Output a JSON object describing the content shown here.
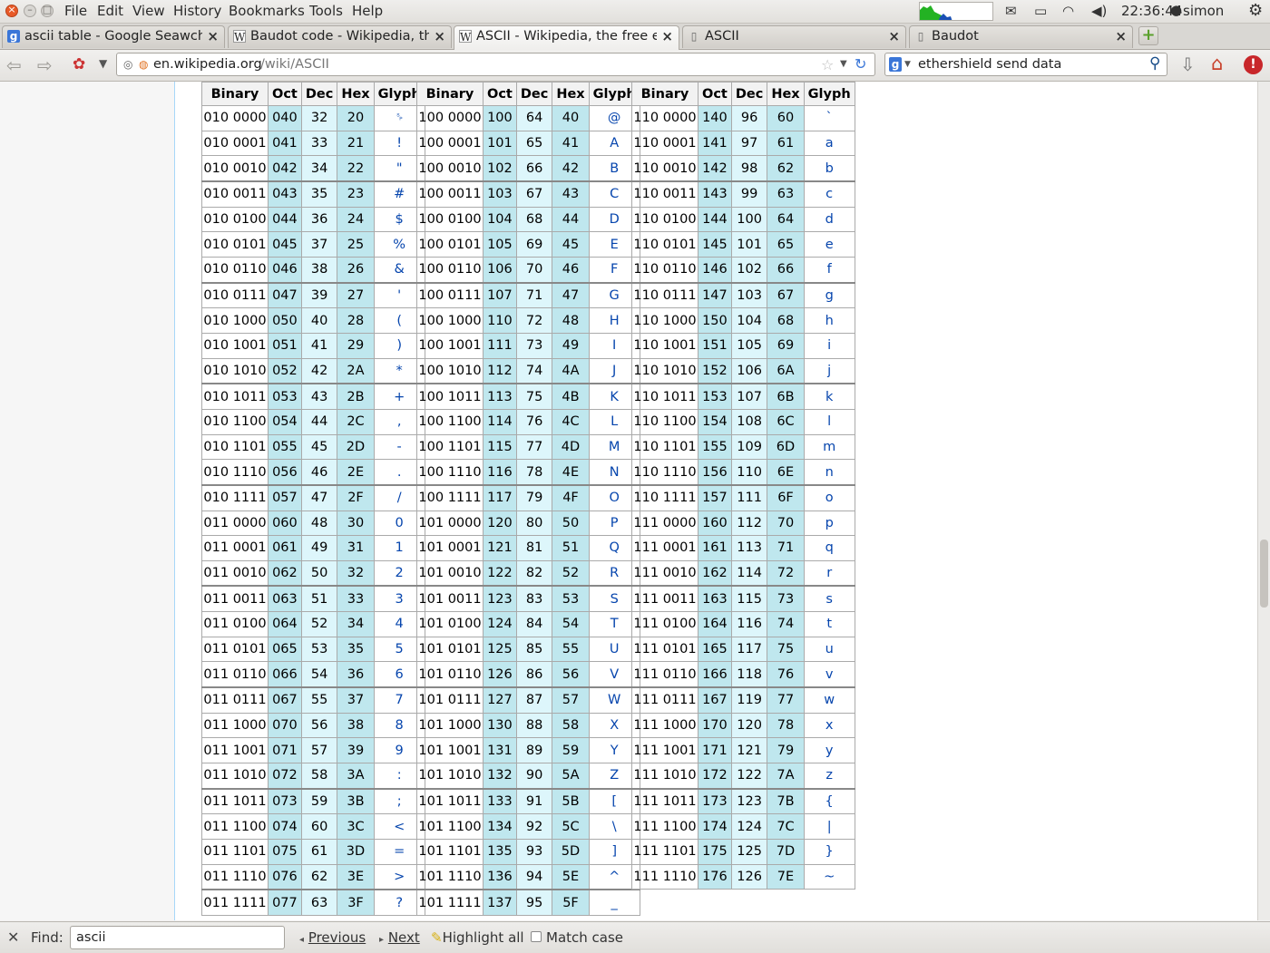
{
  "menubar": {
    "items": [
      "File",
      "Edit",
      "View",
      "History",
      "Bookmarks",
      "Tools",
      "Help"
    ],
    "clock": "22:36:44",
    "user": "simon"
  },
  "tabs": [
    {
      "label": "ascii table - Google Seawch",
      "favicon": "google-icon"
    },
    {
      "label": "Baudot code - Wikipedia, th…",
      "favicon": "wikipedia-icon"
    },
    {
      "label": "ASCII - Wikipedia, the free e…",
      "favicon": "wikipedia-icon",
      "active": true
    },
    {
      "label": "ASCII",
      "favicon": "page-icon"
    },
    {
      "label": "Baudot",
      "favicon": "page-icon"
    }
  ],
  "navbar": {
    "url_domain": "en.wikipedia.org",
    "url_path": "/wiki/ASCII",
    "search_value": "ethershield send data"
  },
  "table": {
    "headers": [
      "Binary",
      "Oct",
      "Dec",
      "Hex",
      "Glyph"
    ],
    "columns": [
      [
        [
          "010 0000",
          "040",
          "32",
          "20",
          "␠"
        ],
        [
          "010 0001",
          "041",
          "33",
          "21",
          "!"
        ],
        [
          "010 0010",
          "042",
          "34",
          "22",
          "\""
        ],
        [
          "010 0011",
          "043",
          "35",
          "23",
          "#"
        ],
        [
          "010 0100",
          "044",
          "36",
          "24",
          "$"
        ],
        [
          "010 0101",
          "045",
          "37",
          "25",
          "%"
        ],
        [
          "010 0110",
          "046",
          "38",
          "26",
          "&"
        ],
        [
          "010 0111",
          "047",
          "39",
          "27",
          "'"
        ],
        [
          "010 1000",
          "050",
          "40",
          "28",
          "("
        ],
        [
          "010 1001",
          "051",
          "41",
          "29",
          ")"
        ],
        [
          "010 1010",
          "052",
          "42",
          "2A",
          "*"
        ],
        [
          "010 1011",
          "053",
          "43",
          "2B",
          "+"
        ],
        [
          "010 1100",
          "054",
          "44",
          "2C",
          ","
        ],
        [
          "010 1101",
          "055",
          "45",
          "2D",
          "-"
        ],
        [
          "010 1110",
          "056",
          "46",
          "2E",
          "."
        ],
        [
          "010 1111",
          "057",
          "47",
          "2F",
          "/"
        ],
        [
          "011 0000",
          "060",
          "48",
          "30",
          "0"
        ],
        [
          "011 0001",
          "061",
          "49",
          "31",
          "1"
        ],
        [
          "011 0010",
          "062",
          "50",
          "32",
          "2"
        ],
        [
          "011 0011",
          "063",
          "51",
          "33",
          "3"
        ],
        [
          "011 0100",
          "064",
          "52",
          "34",
          "4"
        ],
        [
          "011 0101",
          "065",
          "53",
          "35",
          "5"
        ],
        [
          "011 0110",
          "066",
          "54",
          "36",
          "6"
        ],
        [
          "011 0111",
          "067",
          "55",
          "37",
          "7"
        ],
        [
          "011 1000",
          "070",
          "56",
          "38",
          "8"
        ],
        [
          "011 1001",
          "071",
          "57",
          "39",
          "9"
        ],
        [
          "011 1010",
          "072",
          "58",
          "3A",
          ":"
        ],
        [
          "011 1011",
          "073",
          "59",
          "3B",
          ";"
        ],
        [
          "011 1100",
          "074",
          "60",
          "3C",
          "<"
        ],
        [
          "011 1101",
          "075",
          "61",
          "3D",
          "="
        ],
        [
          "011 1110",
          "076",
          "62",
          "3E",
          ">"
        ],
        [
          "011 1111",
          "077",
          "63",
          "3F",
          "?"
        ]
      ],
      [
        [
          "100 0000",
          "100",
          "64",
          "40",
          "@"
        ],
        [
          "100 0001",
          "101",
          "65",
          "41",
          "A"
        ],
        [
          "100 0010",
          "102",
          "66",
          "42",
          "B"
        ],
        [
          "100 0011",
          "103",
          "67",
          "43",
          "C"
        ],
        [
          "100 0100",
          "104",
          "68",
          "44",
          "D"
        ],
        [
          "100 0101",
          "105",
          "69",
          "45",
          "E"
        ],
        [
          "100 0110",
          "106",
          "70",
          "46",
          "F"
        ],
        [
          "100 0111",
          "107",
          "71",
          "47",
          "G"
        ],
        [
          "100 1000",
          "110",
          "72",
          "48",
          "H"
        ],
        [
          "100 1001",
          "111",
          "73",
          "49",
          "I"
        ],
        [
          "100 1010",
          "112",
          "74",
          "4A",
          "J"
        ],
        [
          "100 1011",
          "113",
          "75",
          "4B",
          "K"
        ],
        [
          "100 1100",
          "114",
          "76",
          "4C",
          "L"
        ],
        [
          "100 1101",
          "115",
          "77",
          "4D",
          "M"
        ],
        [
          "100 1110",
          "116",
          "78",
          "4E",
          "N"
        ],
        [
          "100 1111",
          "117",
          "79",
          "4F",
          "O"
        ],
        [
          "101 0000",
          "120",
          "80",
          "50",
          "P"
        ],
        [
          "101 0001",
          "121",
          "81",
          "51",
          "Q"
        ],
        [
          "101 0010",
          "122",
          "82",
          "52",
          "R"
        ],
        [
          "101 0011",
          "123",
          "83",
          "53",
          "S"
        ],
        [
          "101 0100",
          "124",
          "84",
          "54",
          "T"
        ],
        [
          "101 0101",
          "125",
          "85",
          "55",
          "U"
        ],
        [
          "101 0110",
          "126",
          "86",
          "56",
          "V"
        ],
        [
          "101 0111",
          "127",
          "87",
          "57",
          "W"
        ],
        [
          "101 1000",
          "130",
          "88",
          "58",
          "X"
        ],
        [
          "101 1001",
          "131",
          "89",
          "59",
          "Y"
        ],
        [
          "101 1010",
          "132",
          "90",
          "5A",
          "Z"
        ],
        [
          "101 1011",
          "133",
          "91",
          "5B",
          "["
        ],
        [
          "101 1100",
          "134",
          "92",
          "5C",
          "\\"
        ],
        [
          "101 1101",
          "135",
          "93",
          "5D",
          "]"
        ],
        [
          "101 1110",
          "136",
          "94",
          "5E",
          "^"
        ],
        [
          "101 1111",
          "137",
          "95",
          "5F",
          "_"
        ]
      ],
      [
        [
          "110 0000",
          "140",
          "96",
          "60",
          "`"
        ],
        [
          "110 0001",
          "141",
          "97",
          "61",
          "a"
        ],
        [
          "110 0010",
          "142",
          "98",
          "62",
          "b"
        ],
        [
          "110 0011",
          "143",
          "99",
          "63",
          "c"
        ],
        [
          "110 0100",
          "144",
          "100",
          "64",
          "d"
        ],
        [
          "110 0101",
          "145",
          "101",
          "65",
          "e"
        ],
        [
          "110 0110",
          "146",
          "102",
          "66",
          "f"
        ],
        [
          "110 0111",
          "147",
          "103",
          "67",
          "g"
        ],
        [
          "110 1000",
          "150",
          "104",
          "68",
          "h"
        ],
        [
          "110 1001",
          "151",
          "105",
          "69",
          "i"
        ],
        [
          "110 1010",
          "152",
          "106",
          "6A",
          "j"
        ],
        [
          "110 1011",
          "153",
          "107",
          "6B",
          "k"
        ],
        [
          "110 1100",
          "154",
          "108",
          "6C",
          "l"
        ],
        [
          "110 1101",
          "155",
          "109",
          "6D",
          "m"
        ],
        [
          "110 1110",
          "156",
          "110",
          "6E",
          "n"
        ],
        [
          "110 1111",
          "157",
          "111",
          "6F",
          "o"
        ],
        [
          "111 0000",
          "160",
          "112",
          "70",
          "p"
        ],
        [
          "111 0001",
          "161",
          "113",
          "71",
          "q"
        ],
        [
          "111 0010",
          "162",
          "114",
          "72",
          "r"
        ],
        [
          "111 0011",
          "163",
          "115",
          "73",
          "s"
        ],
        [
          "111 0100",
          "164",
          "116",
          "74",
          "t"
        ],
        [
          "111 0101",
          "165",
          "117",
          "75",
          "u"
        ],
        [
          "111 0110",
          "166",
          "118",
          "76",
          "v"
        ],
        [
          "111 0111",
          "167",
          "119",
          "77",
          "w"
        ],
        [
          "111 1000",
          "170",
          "120",
          "78",
          "x"
        ],
        [
          "111 1001",
          "171",
          "121",
          "79",
          "y"
        ],
        [
          "111 1010",
          "172",
          "122",
          "7A",
          "z"
        ],
        [
          "111 1011",
          "173",
          "123",
          "7B",
          "{"
        ],
        [
          "111 1100",
          "174",
          "124",
          "7C",
          "|"
        ],
        [
          "111 1101",
          "175",
          "125",
          "7D",
          "}"
        ],
        [
          "111 1110",
          "176",
          "126",
          "7E",
          "~"
        ]
      ]
    ]
  },
  "findbar": {
    "label": "Find:",
    "value": "ascii",
    "previous": "Previous",
    "next": "Next",
    "highlight": "Highlight all",
    "match_case": "Match case"
  }
}
